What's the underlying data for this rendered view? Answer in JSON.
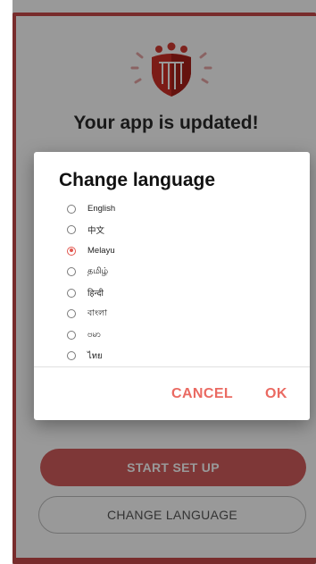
{
  "screen": {
    "title": "Your app is updated!",
    "start_button": "START SET UP",
    "change_language_button": "CHANGE LANGUAGE",
    "logo_icon": "app-logo-icon"
  },
  "dialog": {
    "title": "Change language",
    "options": [
      {
        "label": "English",
        "selected": false
      },
      {
        "label": "中文",
        "selected": false
      },
      {
        "label": "Melayu",
        "selected": true
      },
      {
        "label": "தமிழ்",
        "selected": false
      },
      {
        "label": "हिन्दी",
        "selected": false
      },
      {
        "label": "বাংলা",
        "selected": false
      },
      {
        "label": "ဗမာ",
        "selected": false
      },
      {
        "label": "ไทย",
        "selected": false
      }
    ],
    "cancel_label": "CANCEL",
    "ok_label": "OK"
  },
  "colors": {
    "accent": "#ea6a62",
    "brand_red": "#c94a4a",
    "primary_button": "#d35d5d"
  }
}
